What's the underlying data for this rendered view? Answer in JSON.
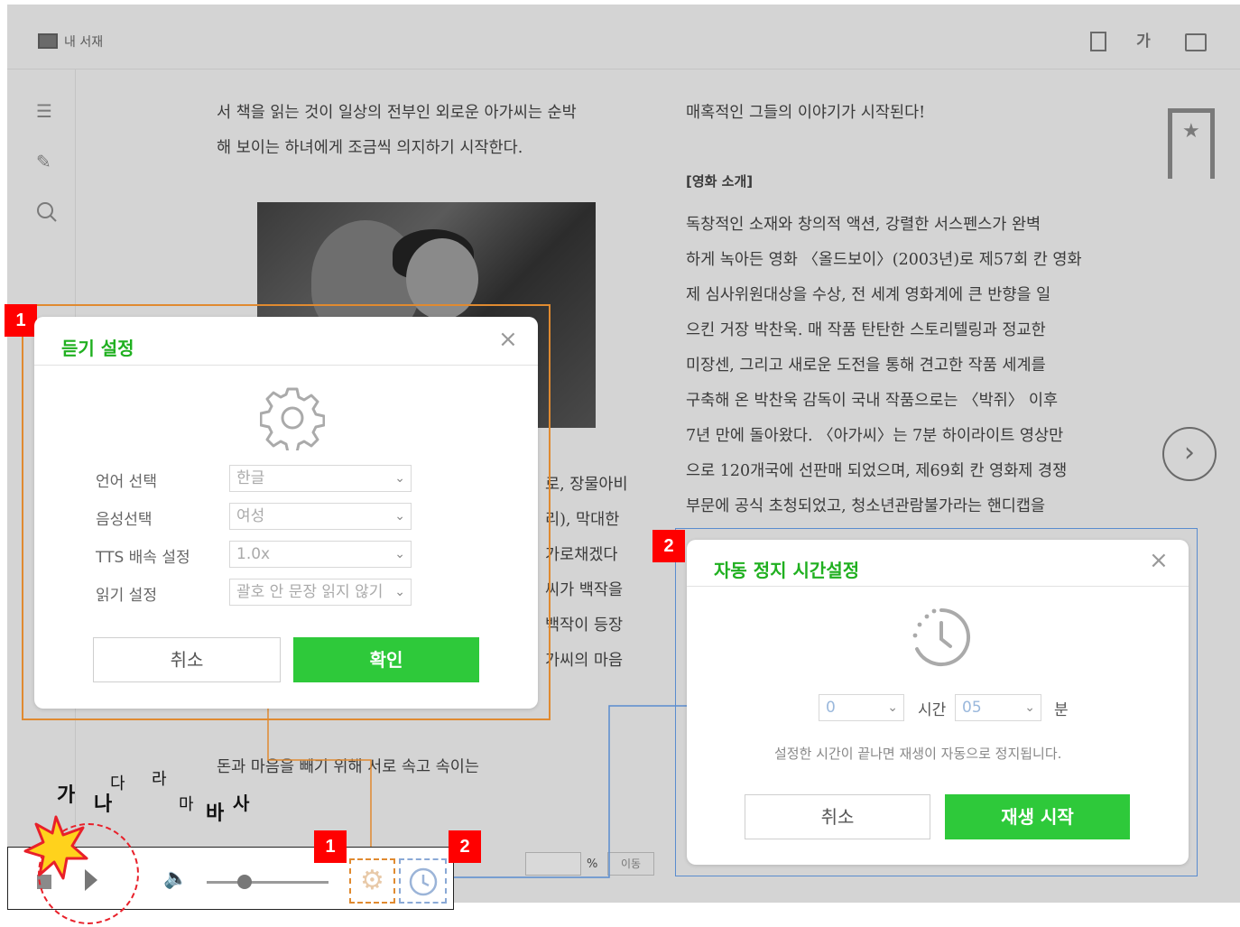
{
  "header": {
    "library_label": "내 서재",
    "font_icon_label": "가"
  },
  "sidebar": {
    "icons": [
      "list-icon",
      "memo-icon",
      "search-icon"
    ]
  },
  "page": {
    "left_top": [
      "서 책을 읽는 것이 일상의 전부인 외로운 아가씨는 순박",
      "해 보이는 하녀에게 조금씩 의지하기 시작한다."
    ],
    "left_mid": [
      "로, 장물아비",
      "리), 막대한",
      "가로채겠다",
      "씨가 백작을",
      "백작이 등장",
      "가씨의 마음"
    ],
    "left_bottom": "돈과 마음을 빼기 위해 서로 속고 속이는",
    "right_top": "매혹적인 그들의 이야기가 시작된다!",
    "right_heading": "[영화 소개]",
    "right_body": [
      "독창적인 소재와 창의적 액션, 강렬한 서스펜스가 완벽",
      "하게 녹아든 영화 〈올드보이〉(2003년)로 제57회 칸 영화",
      "제 심사위원대상을 수상, 전 세계 영화계에 큰 반향을 일",
      "으킨 거장 박찬욱. 매 작품 탄탄한 스토리텔링과 정교한",
      "미장센, 그리고 새로운 도전을 통해 견고한 작품 세계를",
      "구축해 온 박찬욱 감독이 국내 작품으로는 〈박쥐〉 이후",
      "7년 만에 돌아왔다. 〈아가씨〉는 7분 하이라이트 영상만",
      "으로 120개국에 선판매 되었으며, 제69회 칸 영화제 경쟁",
      "부문에 공식 초청되었고, 청소년관람불가라는 핸디캡을"
    ],
    "percent_sign": "%",
    "move_button": "이동"
  },
  "badges": {
    "listen": "1",
    "timer": "2"
  },
  "listen_dialog": {
    "title": "듣기 설정",
    "rows": [
      {
        "label": "언어 선택",
        "value": "한글"
      },
      {
        "label": "음성선택",
        "value": "여성"
      },
      {
        "label": "TTS 배속 설정",
        "value": "1.0x"
      },
      {
        "label": "읽기 설정",
        "value": "괄호 안 문장 읽지 않기"
      }
    ],
    "cancel": "취소",
    "confirm": "확인"
  },
  "timer_dialog": {
    "title": "자동 정지 시간설정",
    "hour_value": "0",
    "hour_unit": "시간",
    "minute_value": "05",
    "minute_unit": "분",
    "note": "설정한 시간이 끝나면 재생이 자동으로 정지됩니다.",
    "cancel": "취소",
    "start": "재생 시작"
  },
  "font_sample": [
    "가",
    "나",
    "다",
    "라",
    "마",
    "바",
    "사"
  ],
  "colors": {
    "accent_green": "#2ec93a",
    "title_green": "#20b020",
    "badge_red": "#ff0000",
    "frame_orange": "#e08a30",
    "frame_blue": "#5a8ccf"
  }
}
